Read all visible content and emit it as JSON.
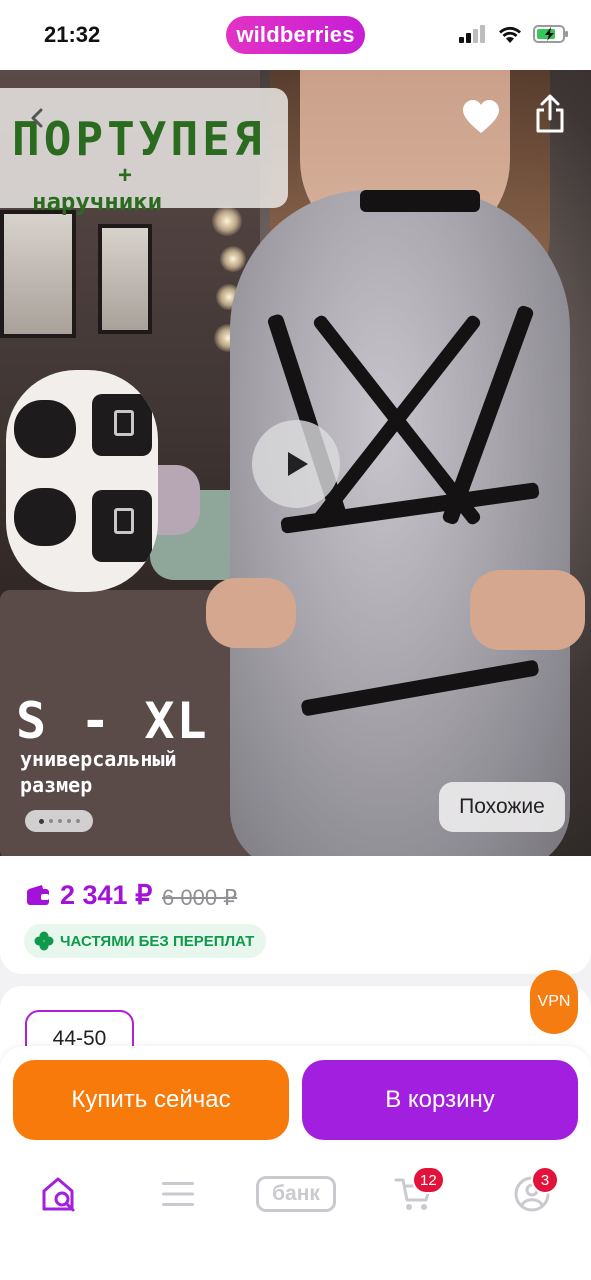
{
  "status_bar": {
    "time": "21:32",
    "brand_logo": "wildberries",
    "icons": [
      "cellular-signal-icon",
      "wifi-icon",
      "battery-charging-icon"
    ]
  },
  "hero": {
    "promo_title": "ПОРТУПЕЯ",
    "promo_plus": "+",
    "promo_subtitle": "наручники",
    "size_range": "S - XL",
    "size_note": "универсальный размер",
    "similar_label": "Похожие",
    "slide_count": 5,
    "active_slide": 1,
    "icons": [
      "back-arrow-icon",
      "heart-icon",
      "share-icon",
      "play-icon"
    ]
  },
  "price": {
    "current": "2 341 ₽",
    "old": "6 000 ₽",
    "installment_label": "ЧАСТЯМИ БЕЗ ПЕРЕПЛАТ",
    "accent_color": "#a312d8",
    "installment_color": "#0e9a4a"
  },
  "sizes": {
    "selected": "44-50"
  },
  "vpn_label": "VPN",
  "actions": {
    "buy_now": "Купить сейчас",
    "add_to_cart": "В корзину",
    "buy_color": "#f77a0b",
    "cart_color": "#a31fe0"
  },
  "tabbar": {
    "home_icon": "home-search-icon",
    "catalog_icon": "menu-icon",
    "bank_label": "банк",
    "cart_badge": "12",
    "profile_badge": "3"
  }
}
